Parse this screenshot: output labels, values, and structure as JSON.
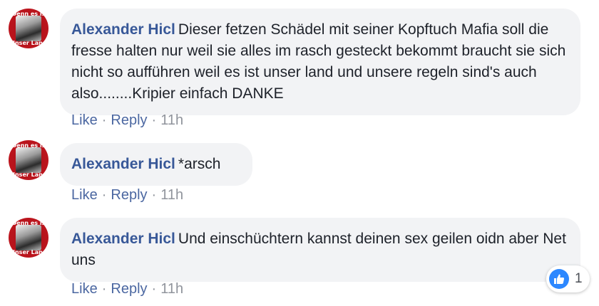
{
  "comments": [
    {
      "author": "Alexander Hicl",
      "text": "Dieser fetzen Schädel mit seiner Kopftuch Mafia soll die fresse halten nur weil sie alles im rasch gesteckt bekommt braucht sie sich nicht so aufführen weil es ist unser land und unsere regeln sind's auch also........Kripier einfach DANKE",
      "like_label": "Like",
      "reply_label": "Reply",
      "time": "11h"
    },
    {
      "author": "Alexander Hicl",
      "text": "*arsch",
      "like_label": "Like",
      "reply_label": "Reply",
      "time": "11h"
    },
    {
      "author": "Alexander Hicl",
      "text": "Und einschüchtern kannst deinen sex geilen oidn aber Net uns",
      "like_label": "Like",
      "reply_label": "Reply",
      "time": "11h",
      "reaction": {
        "icon": "thumbs-up-icon",
        "count": "1",
        "color": "#2d88ff"
      }
    }
  ],
  "avatar": {
    "top_text": "Denn es is",
    "bottom_text": "Unser Land"
  },
  "separator": "·",
  "colors": {
    "author": "#385898",
    "link": "#4b67a1",
    "bubble": "#f2f3f5",
    "muted": "#90949c"
  }
}
